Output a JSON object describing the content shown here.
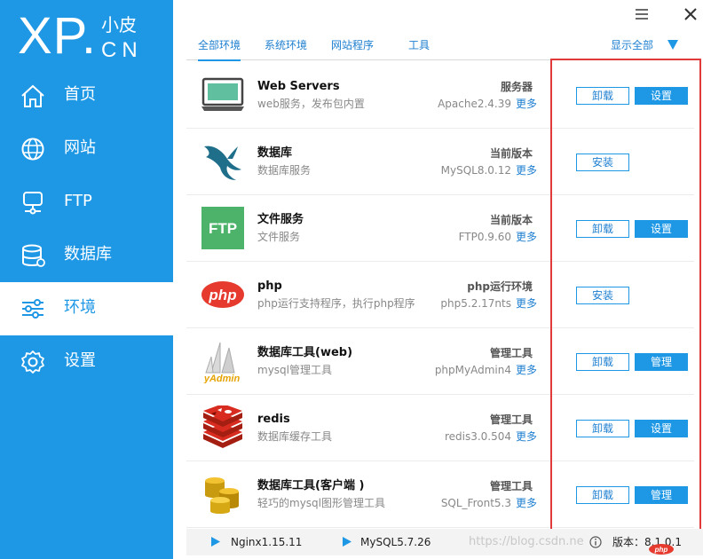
{
  "logo": {
    "brand": "XP.",
    "cn_top": "小皮",
    "cn_bottom": "CN"
  },
  "sidebar": {
    "items": [
      {
        "label": "首页",
        "icon": "home-icon",
        "active": false
      },
      {
        "label": "网站",
        "icon": "globe-icon",
        "active": false
      },
      {
        "label": "FTP",
        "icon": "server-icon",
        "active": false
      },
      {
        "label": "数据库",
        "icon": "database-icon",
        "active": false
      },
      {
        "label": "环境",
        "icon": "sliders-icon",
        "active": true
      },
      {
        "label": "设置",
        "icon": "gear-icon",
        "active": false
      }
    ]
  },
  "tabs": [
    {
      "label": "全部环境",
      "active": true
    },
    {
      "label": "系统环境",
      "active": false
    },
    {
      "label": "网站程序",
      "active": false
    },
    {
      "label": "工具",
      "active": false
    }
  ],
  "show_all": "显示全部",
  "rows": [
    {
      "title": "Web Servers",
      "desc": "web服务，发布包内置",
      "kind": "服务器",
      "version": "Apache2.4.39",
      "more": "更多",
      "buttons": [
        "卸载",
        "设置"
      ],
      "icon": "monitor-icon"
    },
    {
      "title": "数据库",
      "desc": "数据库服务",
      "kind": "当前版本",
      "version": "MySQL8.0.12",
      "more": "更多",
      "buttons": [
        "安装"
      ],
      "icon": "mysql-dolphin-icon"
    },
    {
      "title": "文件服务",
      "desc": "文件服务",
      "kind": "当前版本",
      "version": "FTP0.9.60",
      "more": "更多",
      "buttons": [
        "卸载",
        "设置"
      ],
      "icon": "ftp-icon",
      "icon_text": "FTP"
    },
    {
      "title": "php",
      "desc": "php运行支持程序，执行php程序",
      "kind": "php运行环境",
      "version": "php5.2.17nts",
      "more": "更多",
      "buttons": [
        "安装"
      ],
      "icon": "php-icon",
      "icon_text": "php"
    },
    {
      "title": "数据库工具(web)",
      "desc": "mysql管理工具",
      "kind": "管理工具",
      "version": "phpMyAdmin4",
      "more": "更多",
      "buttons": [
        "卸载",
        "管理"
      ],
      "icon": "phpmyadmin-icon",
      "icon_text": "yAdmin"
    },
    {
      "title": "redis",
      "desc": "数据库缓存工具",
      "kind": "管理工具",
      "version": "redis3.0.504",
      "more": "更多",
      "buttons": [
        "卸载",
        "设置"
      ],
      "icon": "redis-icon"
    },
    {
      "title": "数据库工具(客户端 )",
      "desc": "轻巧的mysql图形管理工具",
      "kind": "管理工具",
      "version": "SQL_Front5.3",
      "more": "更多",
      "buttons": [
        "卸载",
        "管理"
      ],
      "icon": "sqlfront-icon"
    }
  ],
  "status": {
    "nginx": "Nginx1.15.11",
    "mysql": "MySQL5.7.26",
    "version": "版本：8.1.0.1",
    "watermark": "https://blog.csdn.ne",
    "php_badge": "php"
  },
  "colors": {
    "accent": "#1e97e5",
    "highlight": "#e03a3a",
    "ftp_green": "#4db36a",
    "php_red": "#e53a2d",
    "redis_red": "#c9302c"
  }
}
